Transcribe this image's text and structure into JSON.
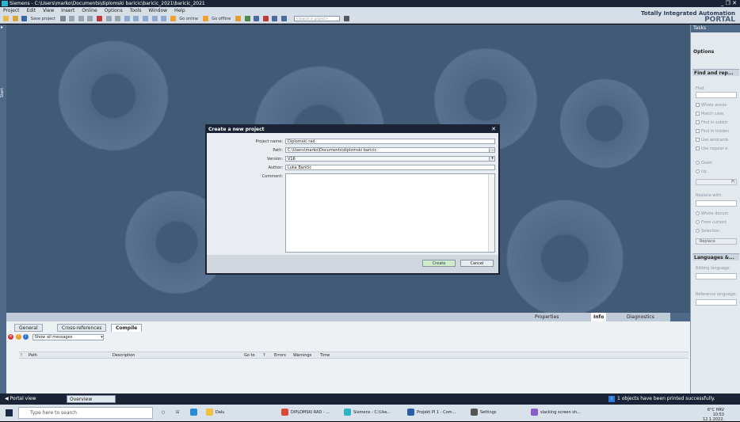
{
  "window": {
    "title": "Siemens - C:\\Users\\marko\\Documents\\diplomski baricic\\baricic_2021\\baricic_2021",
    "controls": "_ ❐ ✕"
  },
  "menu": [
    "Project",
    "Edit",
    "View",
    "Insert",
    "Online",
    "Options",
    "Tools",
    "Window",
    "Help"
  ],
  "toolbar": {
    "save_project": "Save project",
    "go_online": "Go online",
    "go_offline": "Go offline",
    "search_placeholder": "<Search in project>"
  },
  "branding": {
    "line1": "Totally Integrated Automation",
    "line2": "PORTAL"
  },
  "left_strip": {
    "label": "Start"
  },
  "dialog": {
    "title": "Create a new project",
    "fields": [
      {
        "label": "Project name:",
        "value": "Diplomski rad"
      },
      {
        "label": "Path:",
        "value": "C:\\Users\\marko\\Documents\\diplomski baricic"
      },
      {
        "label": "Version:",
        "value": "V16"
      },
      {
        "label": "Author:",
        "value": "Luka Baričić"
      },
      {
        "label": "Comment:",
        "value": ""
      }
    ],
    "create_label": "Create",
    "cancel_label": "Cancel"
  },
  "inspector_tabs": {
    "properties": "Properties",
    "info": "Info",
    "diagnostics": "Diagnostics"
  },
  "inspector": {
    "tabs": [
      "General",
      "Cross-references",
      "Compile"
    ],
    "active_tab": "Compile",
    "filter_value": "Show all messages",
    "columns": [
      "!",
      "Path",
      "Description",
      "Go to",
      "?",
      "Errors",
      "Warnings",
      "Time"
    ]
  },
  "task_panel": {
    "header": "Tasks",
    "options_label": "Options",
    "find_section": "Find and rep...",
    "find_label": "Find:",
    "checks": [
      "Whole words",
      "Match case",
      "Find in substr",
      "Find in hidden",
      "Use wildcards",
      "Use regular e"
    ],
    "radios": [
      "Down",
      "Up"
    ],
    "find_button": "Fi",
    "replace_label": "Replace with:",
    "scope_radios": [
      "Whole docum",
      "From current",
      "Selection"
    ],
    "replace_button": "Replace",
    "lang_section": "Languages &...",
    "editing_language": "Editing language:",
    "reference_language": "Reference language:"
  },
  "statusbar": {
    "portal_view": "Portal view",
    "overview": "Overview",
    "message": "1 objects have been printed successfully."
  },
  "taskbar": {
    "search_placeholder": "Type here to search",
    "items": [
      "Dalu",
      "DIPLOMSKI RAD - ...",
      "Siemens - C:\\Use...",
      "Projekt PI 1 - Com...",
      "Settings",
      "slacking screen sh..."
    ],
    "weather": "6°C",
    "lang": "HRV",
    "time": "10:53",
    "date": "12.1.2022."
  },
  "colors": {
    "dark_bar": "#1b2436",
    "workspace": "#415a76",
    "accent_green": "#cfeccd",
    "panel_blue": "#4f6a89"
  }
}
